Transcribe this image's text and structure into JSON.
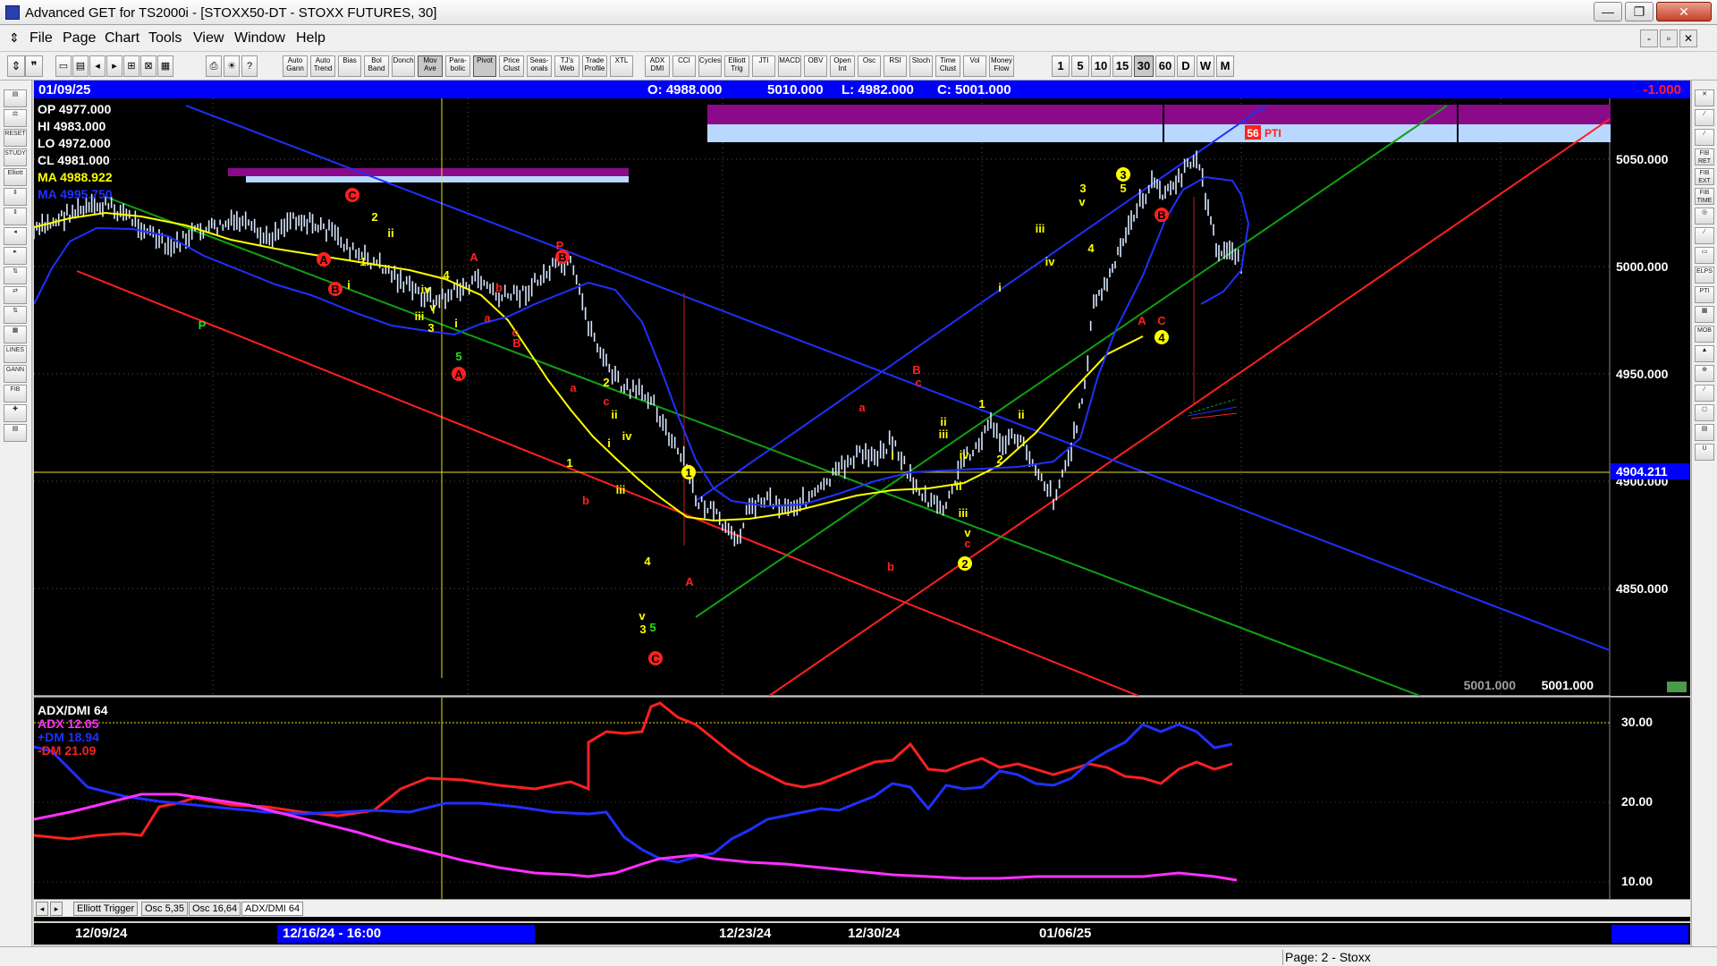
{
  "window": {
    "title": "Advanced GET for TS2000i - [STOXX50-DT - STOXX FUTURES, 30]",
    "controls": [
      "—",
      "❐",
      "✕"
    ]
  },
  "menu": {
    "items": [
      "File",
      "Page",
      "Chart",
      "Tools",
      "View",
      "Window",
      "Help"
    ],
    "mdi_controls": [
      "-",
      "▫",
      "✕"
    ]
  },
  "toolbar": {
    "study_buttons": [
      "Auto Gann",
      "Auto Trend",
      "Bias",
      "Bol Band",
      "Donch",
      "Mov Ave",
      "Para-bolic",
      "Pivot",
      "Price Clust",
      "Seas-onals",
      "TJ's Web",
      "Trade Profile",
      "XTL",
      "ADX DMI",
      "CCI",
      "Cycles",
      "Elliott Trig",
      "JTI",
      "MACD",
      "OBV",
      "Open Int",
      "Osc",
      "RSI",
      "Stoch",
      "Time Clust",
      "Vol",
      "Money Flow"
    ],
    "interval_buttons": [
      "1",
      "5",
      "10",
      "15",
      "30",
      "60",
      "D",
      "W",
      "M"
    ],
    "active_interval": "30"
  },
  "header": {
    "date": "01/09/25",
    "open": "O: 4988.000",
    "high": "5010.000",
    "low": "L: 4982.000",
    "close": "C: 5001.000",
    "change": "-1.000"
  },
  "info_panel": [
    {
      "label": "OP",
      "value": "4977.000",
      "color": "#ffffff"
    },
    {
      "label": "HI",
      "value": "4983.000",
      "color": "#ffffff"
    },
    {
      "label": "LO",
      "value": "4972.000",
      "color": "#ffffff"
    },
    {
      "label": "CL",
      "value": "4981.000",
      "color": "#ffffff"
    },
    {
      "label": "MA",
      "value": "4988.922",
      "color": "#ffff00"
    },
    {
      "label": "MA",
      "value": "4995.750",
      "color": "#2030ff"
    }
  ],
  "price_axis": {
    "labels": [
      "5050.000",
      "5000.000",
      "4950.000",
      "4900.000",
      "4850.000"
    ],
    "current_price": "4904.211",
    "bottom_values": [
      "5001.000",
      "5001.000"
    ]
  },
  "pti": {
    "value": "56",
    "label": "PTI"
  },
  "indicator": {
    "title": "ADX/DMI 64",
    "adx": "ADX 12.05",
    "plus_dm": "+DM 18.94",
    "minus_dm": "-DM 21.09",
    "axis_labels": [
      "30.00",
      "20.00",
      "10.00"
    ]
  },
  "time_axis": {
    "labels": [
      "12/09/24",
      "12/16/24 - 16:00",
      "12/23/24",
      "12/30/24",
      "01/06/25"
    ]
  },
  "tabs": [
    "Elliott Trigger",
    "Osc 5,35",
    "Osc 16,64",
    "ADX/DMI 64"
  ],
  "status": {
    "page": "Page: 2 - Stoxx"
  },
  "colors": {
    "background": "#000000",
    "header_bar": "#0000ff",
    "price_bars": "#d8e8ff",
    "ma_fast": "#ffff00",
    "ma_slow": "#2030ff",
    "channel_red": "#ff2020",
    "channel_blue": "#2030ff",
    "channel_green": "#10a010",
    "adx": "#ff30ff",
    "plus_dm": "#2030ff",
    "minus_dm": "#ff2020",
    "elliott_labels": "#ffff00",
    "abc_labels": "#ff2020"
  }
}
